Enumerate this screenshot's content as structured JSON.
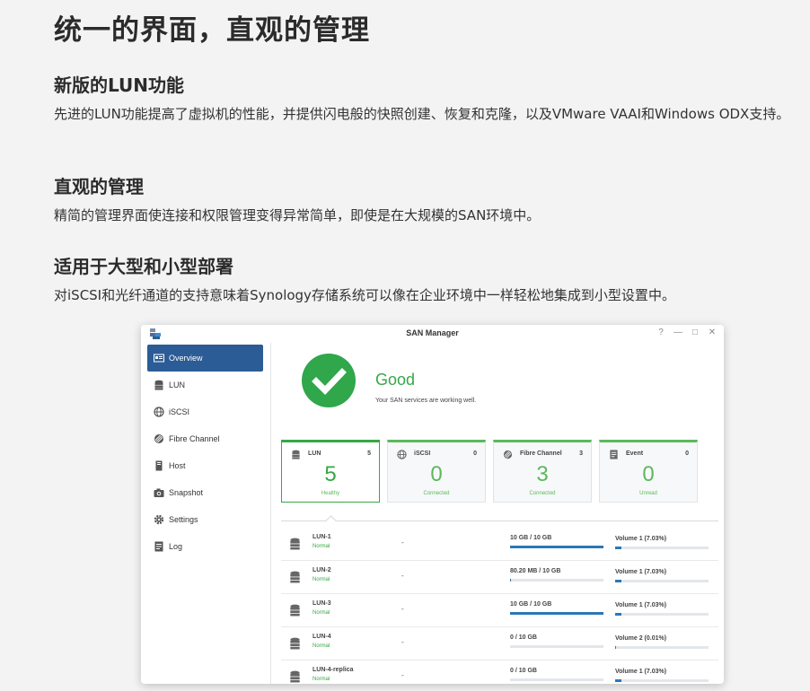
{
  "headline": "统一的界面，直观的管理",
  "sections": [
    {
      "title": "新版的LUN功能",
      "body": "先进的LUN功能提高了虚拟机的性能，并提供闪电般的快照创建、恢复和克隆，以及VMware VAAI和Windows ODX支持。"
    },
    {
      "title": "直观的管理",
      "body": "精简的管理界面使连接和权限管理变得异常简单，即使是在大规模的SAN环境中。"
    },
    {
      "title": "适用于大型和小型部署",
      "body": "对iSCSI和光纤通道的支持意味着Synology存储系统可以像在企业环境中一样轻松地集成到小型设置中。"
    }
  ],
  "window": {
    "title": "SAN Manager",
    "controls": [
      "?",
      "—",
      "□",
      "✕"
    ]
  },
  "sidebar": {
    "items": [
      {
        "label": "Overview",
        "icon": "overview-icon",
        "active": true
      },
      {
        "label": "LUN",
        "icon": "database-icon"
      },
      {
        "label": "iSCSI",
        "icon": "globe-icon"
      },
      {
        "label": "Fibre Channel",
        "icon": "fibre-channel-icon"
      },
      {
        "label": "Host",
        "icon": "host-icon"
      },
      {
        "label": "Snapshot",
        "icon": "camera-icon"
      },
      {
        "label": "Settings",
        "icon": "gear-icon"
      },
      {
        "label": "Log",
        "icon": "log-icon"
      }
    ]
  },
  "status": {
    "title": "Good",
    "message": "Your SAN services are working well.",
    "color": "#37a745"
  },
  "cards": [
    {
      "name": "LUN",
      "count": "5",
      "value": "5",
      "status": "Healthy",
      "icon": "database-icon"
    },
    {
      "name": "iSCSI",
      "count": "0",
      "value": "0",
      "status": "Connected",
      "icon": "globe-icon"
    },
    {
      "name": "Fibre Channel",
      "count": "3",
      "value": "3",
      "status": "Connected",
      "icon": "fibre-channel-icon"
    },
    {
      "name": "Event",
      "count": "0",
      "value": "0",
      "status": "Unread",
      "icon": "event-icon"
    }
  ],
  "luns": [
    {
      "name": "LUN-1",
      "status": "Normal",
      "host": "-",
      "size": "10 GB / 10 GB",
      "size_fraction": 1.0,
      "volume": "Volume 1 (7.03%)",
      "volume_fraction": 0.0703
    },
    {
      "name": "LUN-2",
      "status": "Normal",
      "host": "-",
      "size": "80.20 MB / 10 GB",
      "size_fraction": 0.008,
      "volume": "Volume 1 (7.03%)",
      "volume_fraction": 0.0703
    },
    {
      "name": "LUN-3",
      "status": "Normal",
      "host": "-",
      "size": "10 GB / 10 GB",
      "size_fraction": 1.0,
      "volume": "Volume 1 (7.03%)",
      "volume_fraction": 0.0703
    },
    {
      "name": "LUN-4",
      "status": "Normal",
      "host": "-",
      "size": "0 / 10 GB",
      "size_fraction": 0.0,
      "volume": "Volume 2 (0.01%)",
      "volume_fraction": 0.0001
    },
    {
      "name": "LUN-4-replica",
      "status": "Normal",
      "host": "-",
      "size": "0 / 10 GB",
      "size_fraction": 0.0,
      "volume": "Volume 1 (7.03%)",
      "volume_fraction": 0.0703
    }
  ]
}
